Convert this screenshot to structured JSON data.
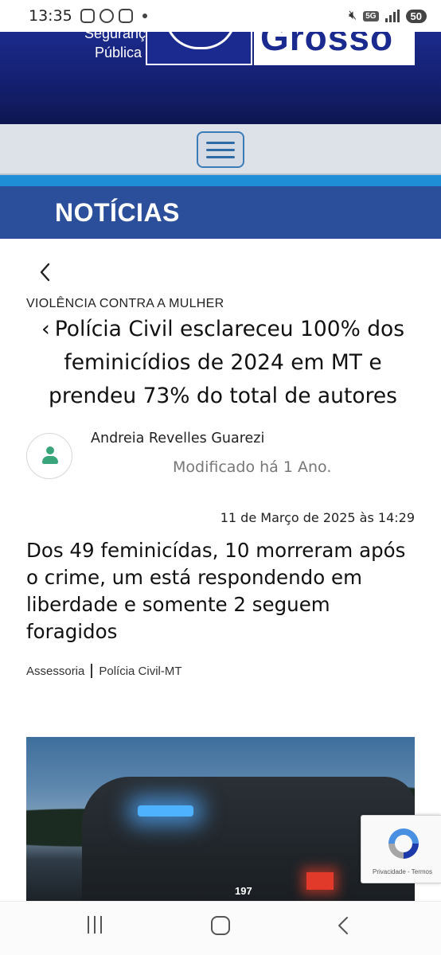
{
  "status_bar": {
    "time": "13:35",
    "network": "5G",
    "battery": "50"
  },
  "header": {
    "org_line1": "Segurança",
    "org_line2": "Pública",
    "state_word": "Grosso"
  },
  "section": {
    "title": "NOTÍCIAS"
  },
  "article": {
    "category": "VIOLÊNCIA CONTRA A MULHER",
    "headline": "Polícia Civil esclareceu 100% dos feminicídios de 2024 em MT e prendeu 73% do total de autores",
    "author": "Andreia Revelles Guarezi",
    "modified": "Modificado há 1 Ano.",
    "date": "11 de Março de 2025 às 14:29",
    "subtitle": "Dos 49 feminicídas, 10 morreram após o crime, um está respondendo em liberdade e somente 2 seguem foragidos",
    "credit_source": "Assessoria",
    "credit_org": "Polícia Civil-MT",
    "photo_number": "197"
  },
  "recaptcha": {
    "links": "Privacidade - Termos"
  },
  "colors": {
    "banner_blue": "#1b2a8c",
    "section_blue": "#2b4f9a",
    "stripe_blue": "#1e8fd6",
    "avatar_green": "#3aa57a"
  },
  "icons": [
    "back-arrow-icon",
    "hamburger-menu-icon",
    "user-icon",
    "recaptcha-icon",
    "nav-recents-icon",
    "nav-home-icon",
    "nav-back-icon"
  ]
}
